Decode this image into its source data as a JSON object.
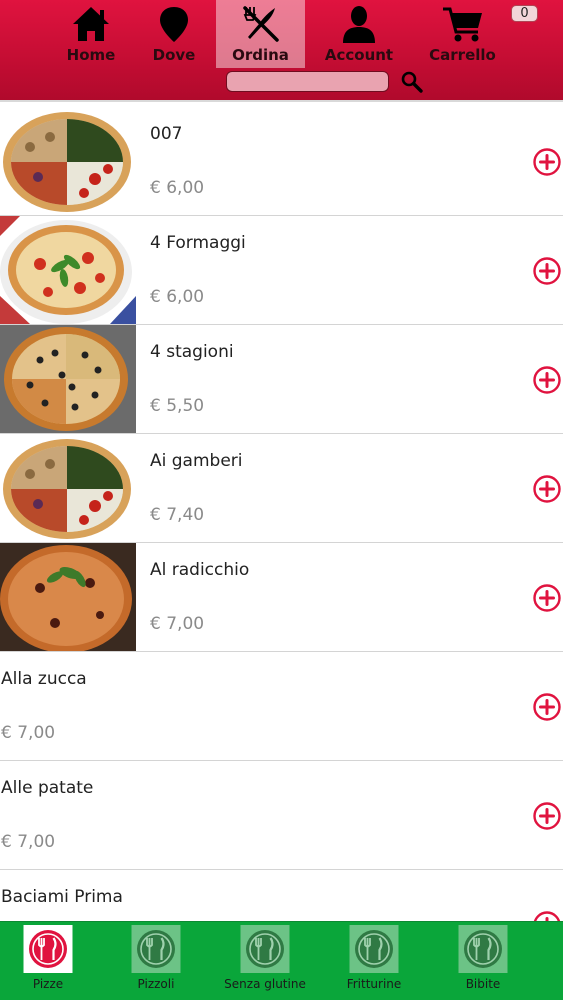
{
  "header": {
    "nav": [
      {
        "label": "Home",
        "icon": "home-icon"
      },
      {
        "label": "Dove",
        "icon": "map-pin-icon"
      },
      {
        "label": "Ordina",
        "icon": "fork-knife-icon",
        "active": true
      },
      {
        "label": "Account",
        "icon": "user-icon"
      },
      {
        "label": "Carrello",
        "icon": "cart-icon"
      }
    ],
    "cart_count": "0",
    "search": {
      "value": "",
      "placeholder": ""
    }
  },
  "products": [
    {
      "name": "007",
      "price": "€ 6,00",
      "has_image": true
    },
    {
      "name": "4 Formaggi",
      "price": "€ 6,00",
      "has_image": true
    },
    {
      "name": "4 stagioni",
      "price": "€ 5,50",
      "has_image": true
    },
    {
      "name": "Ai gamberi",
      "price": "€ 7,40",
      "has_image": true
    },
    {
      "name": "Al radicchio",
      "price": "€ 7,00",
      "has_image": true
    },
    {
      "name": "Alla zucca",
      "price": "€ 7,00",
      "has_image": false
    },
    {
      "name": "Alle patate",
      "price": "€ 7,00",
      "has_image": false
    },
    {
      "name": "Baciami Prima",
      "price": "",
      "has_image": false
    }
  ],
  "categories": [
    {
      "label": "Pizze",
      "icon": "plate-cutlery-icon",
      "active": true
    },
    {
      "label": "Pizzoli",
      "icon": "plate-cutlery-icon"
    },
    {
      "label": "Senza glutine",
      "icon": "plate-cutlery-icon"
    },
    {
      "label": "Fritturine",
      "icon": "plate-cutlery-icon"
    },
    {
      "label": "Bibite",
      "icon": "plate-cutlery-icon"
    }
  ],
  "colors": {
    "header_red": "#c40d33",
    "accent_red": "#e0133f",
    "category_green": "#0aa63a",
    "price_gray": "#8a8a8a"
  }
}
